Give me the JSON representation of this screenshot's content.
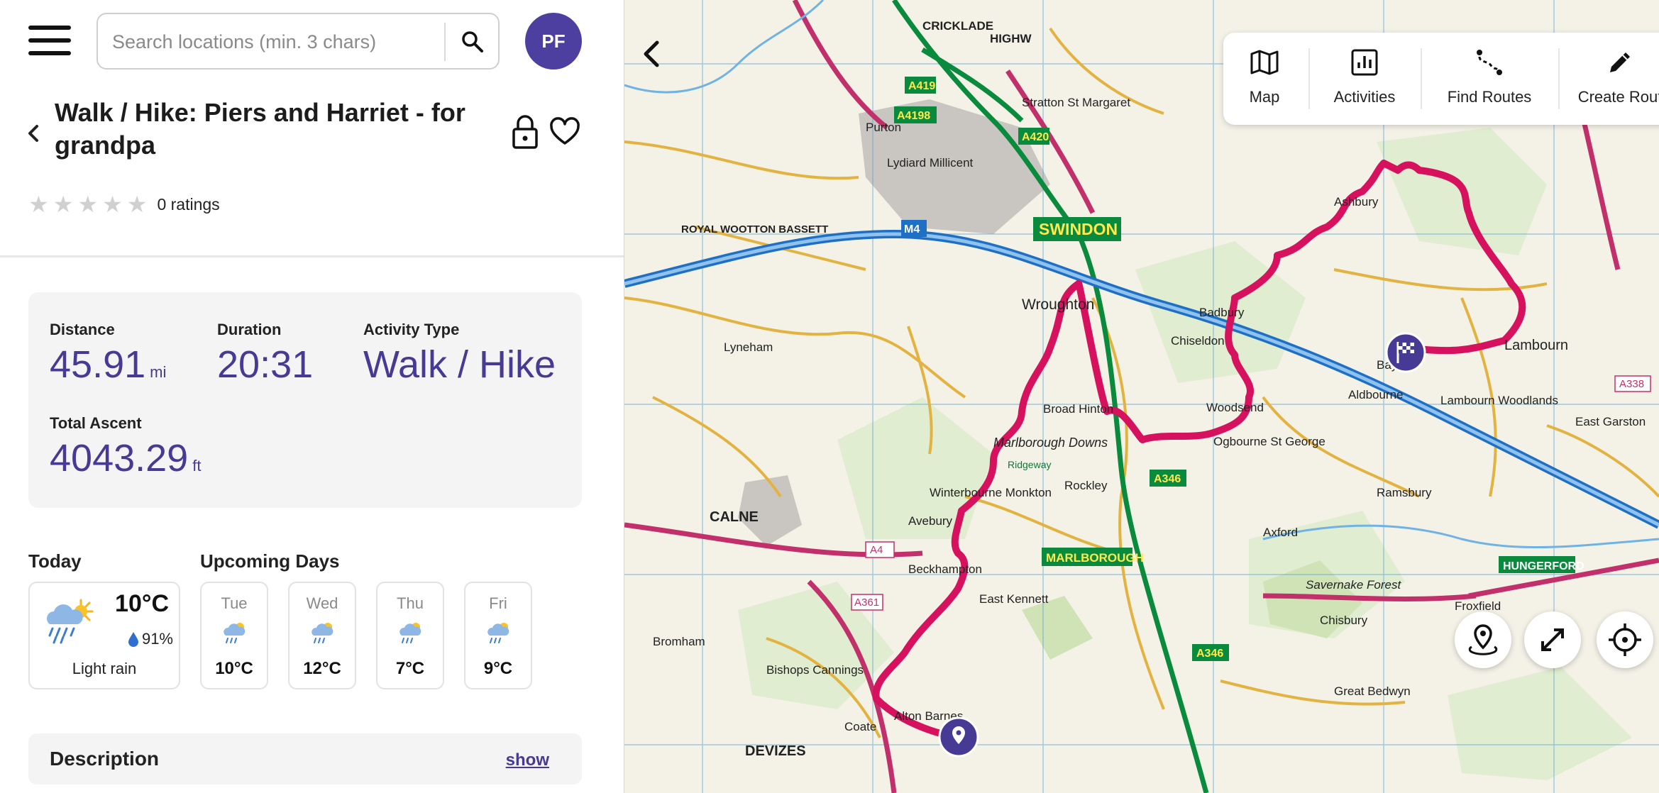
{
  "header": {
    "search_placeholder": "Search locations (min. 3 chars)",
    "avatar_initials": "PF"
  },
  "route": {
    "title": "Walk / Hike: Piers and Harriet - for grandpa",
    "ratings_text": "0 ratings",
    "rating_stars": 0,
    "rating_max": 5
  },
  "stats": {
    "distance_label": "Distance",
    "distance_value": "45.91",
    "distance_unit": "mi",
    "duration_label": "Duration",
    "duration_value": "20:31",
    "activity_label": "Activity Type",
    "activity_value": "Walk / Hike",
    "ascent_label": "Total Ascent",
    "ascent_value": "4043.29",
    "ascent_unit": "ft"
  },
  "weather": {
    "today_heading": "Today",
    "upcoming_heading": "Upcoming Days",
    "today": {
      "temp": "10°C",
      "precip": "91%",
      "condition": "Light rain",
      "icon": "rain-sun-icon"
    },
    "days": [
      {
        "name": "Tue",
        "temp": "10°C",
        "icon": "rain-sun-icon"
      },
      {
        "name": "Wed",
        "temp": "12°C",
        "icon": "rain-sun-icon"
      },
      {
        "name": "Thu",
        "temp": "7°C",
        "icon": "rain-sun-icon"
      },
      {
        "name": "Fri",
        "temp": "9°C",
        "icon": "rain-sun-icon"
      }
    ]
  },
  "description": {
    "title": "Description",
    "show_label": "show"
  },
  "toolbar": {
    "map_label": "Map",
    "activities_label": "Activities",
    "find_routes_label": "Find Routes",
    "create_route_label": "Create Rout"
  },
  "map": {
    "route_color": "#d6125f",
    "accent_color": "#463a94",
    "labels": {
      "swindon": "SWINDON",
      "marlborough": "MARLBOROUGH",
      "hungerford": "HUNGERFORD",
      "devizes": "DEVIZES",
      "calne": "CALNE",
      "wroughton": "Wroughton",
      "chiseldon": "Chiseldon",
      "lambourn": "Lambourn",
      "aldbourne": "Aldbourne",
      "avebury": "Avebury",
      "cricklade": "CRICKLADE",
      "royal_wootton_bassett": "ROYAL WOOTTON BASSETT",
      "stratton": "Stratton St Margaret",
      "purton": "Purton",
      "lyneham": "Lyneham",
      "ogbourne": "Ogbourne St George",
      "froxfield": "Froxfield",
      "chisbury": "Chisbury",
      "east_kennett": "East Kennett",
      "bromham": "Bromham",
      "baydon": "Baydon",
      "ramsbury": "Ramsbury",
      "savernake": "Savernake Forest",
      "marlborough_downs": "Marlborough Downs",
      "m4": "M4",
      "a346": "A346",
      "a4": "A4",
      "a419": "A419",
      "a420": "A420",
      "a4198": "A4198",
      "a361": "A361",
      "a338": "A338",
      "broad_hinton": "Broad Hinton",
      "rockley": "Rockley",
      "highworth": "HIGHW",
      "lydiard": "Lydiard Millicent",
      "badbury": "Badbury",
      "woodsend": "Woodsend",
      "ashbury": "Ashbury",
      "great_bedwyn": "Great Bedwyn",
      "beckhampton": "Beckhampton",
      "coate": "Coate",
      "alton_barnes": "Alton Barnes",
      "bishops_cannings": "Bishops Cannings",
      "winterbourne": "Winterbourne Monkton",
      "lambourn_woodlands": "Lambourn Woodlands",
      "axford": "Axford",
      "east_garston": "East Garston",
      "ridgeway": "Ridgeway"
    }
  }
}
